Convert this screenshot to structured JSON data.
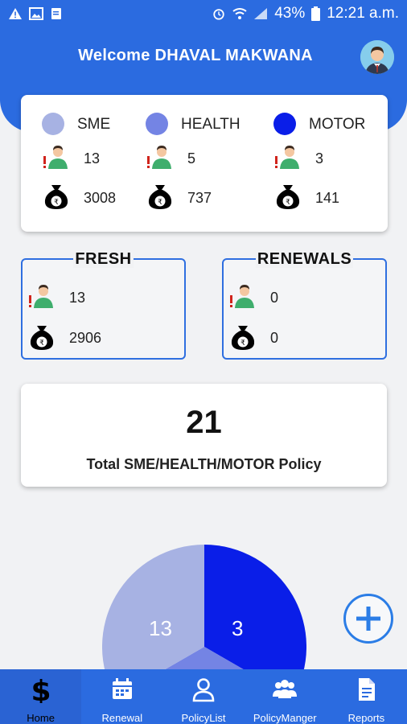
{
  "status_bar": {
    "battery": "43%",
    "time": "12:21 a.m."
  },
  "header": {
    "welcome": "Welcome DHAVAL MAKWANA"
  },
  "summary": {
    "columns": [
      {
        "label": "SME",
        "color": "#a7b2e3",
        "count": "13",
        "amount": "3008"
      },
      {
        "label": "HEALTH",
        "color": "#7484e4",
        "count": "5",
        "amount": "737"
      },
      {
        "label": "MOTOR",
        "color": "#0a1ee8",
        "count": "3",
        "amount": "141"
      }
    ]
  },
  "fresh": {
    "title": "FRESH",
    "count": "13",
    "amount": "2906"
  },
  "renewals": {
    "title": "RENEWALS",
    "count": "0",
    "amount": "0"
  },
  "total": {
    "value": "21",
    "label": "Total SME/HEALTH/MOTOR Policy"
  },
  "pie": {
    "sme_label": "13",
    "motor_label": "3"
  },
  "nav": {
    "items": [
      {
        "label": "Home",
        "icon": "dollar-icon"
      },
      {
        "label": "Renewal",
        "icon": "calendar-icon"
      },
      {
        "label": "PolicyList",
        "icon": "user-icon"
      },
      {
        "label": "PolicyManger",
        "icon": "users-icon"
      },
      {
        "label": "Reports",
        "icon": "document-icon"
      }
    ],
    "active": "Home"
  },
  "colors": {
    "primary": "#2b6be0",
    "sme": "#a7b2e3",
    "health": "#7484e4",
    "motor": "#0a1ee8"
  }
}
